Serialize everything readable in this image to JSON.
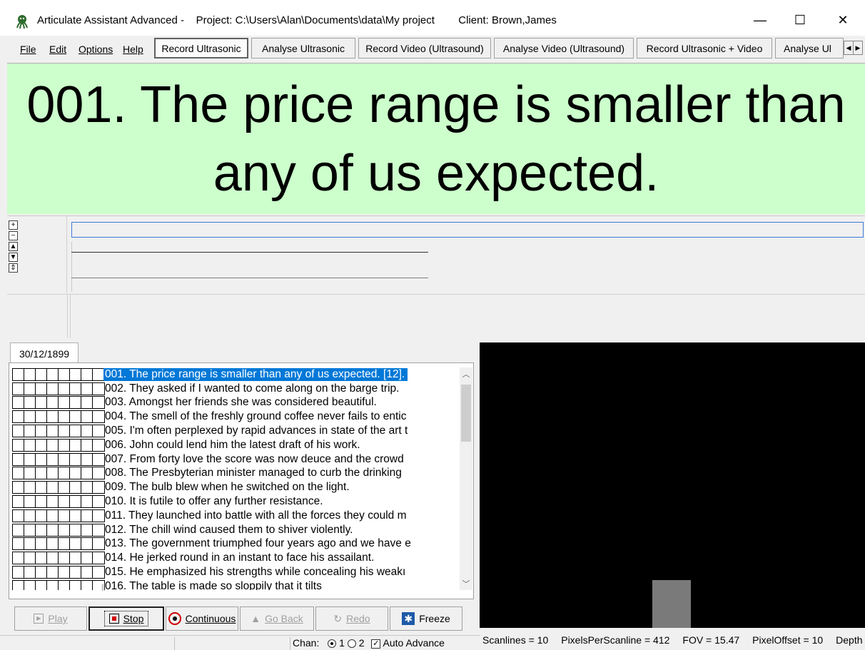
{
  "window": {
    "app_title": "Articulate Assistant Advanced -",
    "project": "Project: C:\\Users\\Alan\\Documents\\data\\My project",
    "client": "Client: Brown,James",
    "minimize": "—",
    "maximize": "☐",
    "close": "✕"
  },
  "menu": [
    {
      "label": "File"
    },
    {
      "label": "Edit"
    },
    {
      "label": "Options"
    },
    {
      "label": "Help"
    }
  ],
  "mode_tabs": [
    {
      "label": "Record Ultrasonic",
      "active": true
    },
    {
      "label": "Analyse Ultrasonic"
    },
    {
      "label": "Record Video (Ultrasound)"
    },
    {
      "label": "Analyse Video (Ultrasound)"
    },
    {
      "label": "Record Ultrasonic + Video"
    },
    {
      "label": "Analyse Ul"
    }
  ],
  "prompt": {
    "text": "001.  The price range is smaller than any of us expected."
  },
  "zoom_controls": [
    "+",
    "−",
    "▲",
    "▼",
    "⇕"
  ],
  "session": {
    "date_tab": "30/12/1899"
  },
  "prompt_list": [
    {
      "text": "001.  The price range is smaller than any of us expected. [12].",
      "selected": true
    },
    {
      "text": "002.  They asked if I wanted to come along on the barge trip."
    },
    {
      "text": "003.  Amongst her friends she was considered beautiful."
    },
    {
      "text": "004.  The smell of the freshly ground coffee never fails to entic"
    },
    {
      "text": "005.  I'm often perplexed by rapid advances in state of the art t"
    },
    {
      "text": "006.  John could lend him the latest draft of his work."
    },
    {
      "text": "007.  From forty love the score was now deuce and the crowd"
    },
    {
      "text": "008.  The Presbyterian minister managed to curb the drinking"
    },
    {
      "text": "009.  The bulb blew when he switched on the light."
    },
    {
      "text": "010.  It is futile to offer any further resistance."
    },
    {
      "text": "011.  They launched into battle with all the forces they could m"
    },
    {
      "text": "012.  The chill wind caused them to shiver violently."
    },
    {
      "text": "013.  The government triumphed four years ago and we have e"
    },
    {
      "text": "014.  He jerked round in an instant to face his assailant."
    },
    {
      "text": "015.  He emphasized his strengths while concealing his weakı"
    },
    {
      "text": "016.  The table is made so sloppily that it tilts"
    }
  ],
  "controls": {
    "play": "Play",
    "stop": "Stop",
    "continuous": "Continuous",
    "go_back": "Go Back",
    "redo": "Redo",
    "freeze": "Freeze"
  },
  "status": {
    "chan_label": "Chan:",
    "chan_1": "1",
    "chan_2": "2",
    "auto_advance": "Auto Advance",
    "scanlines": "Scanlines = 10",
    "pixels_per_scanline": "PixelsPerScanline = 412",
    "fov": "FOV = 15.47",
    "pixel_offset": "PixelOffset = 10",
    "depth": "Depth ="
  }
}
